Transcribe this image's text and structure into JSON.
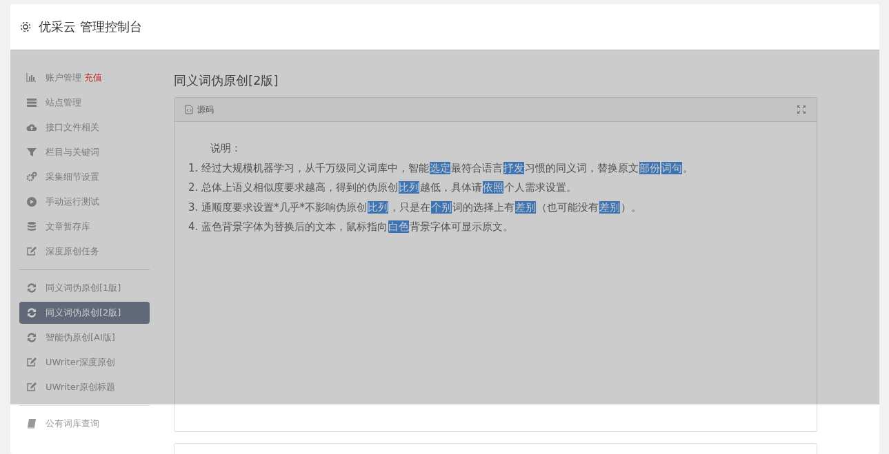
{
  "header": {
    "title": "优采云 管理控制台"
  },
  "sidebar": {
    "groups": [
      {
        "items": [
          {
            "label": "账户管理",
            "badge": "充值",
            "selected": false
          },
          {
            "label": "站点管理",
            "selected": false
          },
          {
            "label": "接口文件相关",
            "selected": false
          },
          {
            "label": "栏目与关键词",
            "selected": false
          },
          {
            "label": "采集细节设置",
            "selected": false
          },
          {
            "label": "手动运行测试",
            "selected": false
          },
          {
            "label": "文章暂存库",
            "selected": false
          },
          {
            "label": "深度原创任务",
            "selected": false
          }
        ]
      },
      {
        "items": [
          {
            "label": "同义词伪原创[1版]",
            "selected": false
          },
          {
            "label": "同义词伪原创[2版]",
            "selected": true
          },
          {
            "label": "智能伪原创[AI版]",
            "selected": false
          },
          {
            "label": "UWriter深度原创",
            "selected": false
          },
          {
            "label": "UWriter原创标题",
            "selected": false
          }
        ]
      },
      {
        "items": [
          {
            "label": "公有词库查询",
            "selected": false
          }
        ]
      }
    ]
  },
  "page_title": "同义词伪原创[2版]",
  "editor": {
    "toolbar_label": "源码",
    "heading": "说明：",
    "lines": [
      {
        "number": "1.",
        "segments": [
          {
            "text": "经过大规模机器学习，从千万级同义词库中，智能",
            "replaced": false
          },
          {
            "text": "选定",
            "replaced": true
          },
          {
            "text": "最符合语言",
            "replaced": false
          },
          {
            "text": "抒发",
            "replaced": true
          },
          {
            "text": "习惯的同义词，替换原文",
            "replaced": false
          },
          {
            "text": "部份",
            "replaced": true
          },
          {
            "text": "词句",
            "replaced": true
          },
          {
            "text": "。",
            "replaced": false
          }
        ]
      },
      {
        "number": "2.",
        "segments": [
          {
            "text": "总体上语义相似度要求越高，得到的伪原创",
            "replaced": false
          },
          {
            "text": "比列",
            "replaced": true
          },
          {
            "text": "越低，具体请",
            "replaced": false
          },
          {
            "text": "依照",
            "replaced": true
          },
          {
            "text": "个人需求设置。",
            "replaced": false
          }
        ]
      },
      {
        "number": "3.",
        "segments": [
          {
            "text": "通顺度要求设置*几乎*不影响伪原创",
            "replaced": false
          },
          {
            "text": "比列",
            "replaced": true
          },
          {
            "text": "，只是在",
            "replaced": false
          },
          {
            "text": "个别",
            "replaced": true
          },
          {
            "text": "词的选择上有",
            "replaced": false
          },
          {
            "text": "差别",
            "replaced": true
          },
          {
            "text": "（也可能没有",
            "replaced": false
          },
          {
            "text": "差别",
            "replaced": true
          },
          {
            "text": "）。",
            "replaced": false
          }
        ]
      },
      {
        "number": "4.",
        "segments": [
          {
            "text": "蓝色背景字体为替换后的文本，鼠标指向",
            "replaced": false
          },
          {
            "text": "白色",
            "replaced": true
          },
          {
            "text": "背景字体可显示原文。",
            "replaced": false
          }
        ]
      }
    ]
  },
  "loading_overlay": {
    "on": true
  }
}
